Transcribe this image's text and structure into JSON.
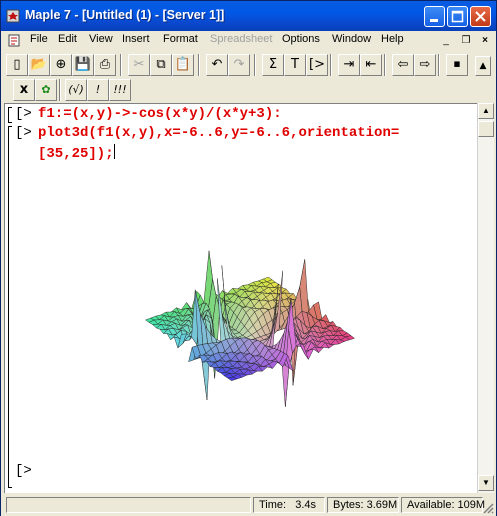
{
  "window": {
    "title": "Maple 7  - [Untitled (1) - [Server 1]]"
  },
  "menu": {
    "items": [
      {
        "label": "File",
        "enabled": true
      },
      {
        "label": "Edit",
        "enabled": true
      },
      {
        "label": "View",
        "enabled": true
      },
      {
        "label": "Insert",
        "enabled": true
      },
      {
        "label": "Format",
        "enabled": true
      },
      {
        "label": "Spreadsheet",
        "enabled": false
      },
      {
        "label": "Options",
        "enabled": true
      },
      {
        "label": "Window",
        "enabled": true
      },
      {
        "label": "Help",
        "enabled": true
      }
    ],
    "mdi_controls": [
      "_",
      "❐",
      "×"
    ]
  },
  "toolbar_main": [
    {
      "icon": "new-document-icon",
      "glyph": "▯"
    },
    {
      "icon": "open-folder-icon",
      "glyph": "📂"
    },
    {
      "icon": "open-url-icon",
      "glyph": "⊕"
    },
    {
      "icon": "save-icon",
      "glyph": "💾"
    },
    {
      "icon": "print-icon",
      "glyph": "⎙"
    },
    {
      "icon": "cut-icon",
      "glyph": "✂"
    },
    {
      "icon": "copy-icon",
      "glyph": "⧉"
    },
    {
      "icon": "paste-icon",
      "glyph": "📋"
    },
    {
      "icon": "undo-icon",
      "glyph": "↶"
    },
    {
      "icon": "redo-icon",
      "glyph": "↷"
    },
    {
      "icon": "sum-icon",
      "glyph": "Σ"
    },
    {
      "icon": "text-icon",
      "glyph": "T"
    },
    {
      "icon": "prompt-icon",
      "glyph": "[>"
    },
    {
      "icon": "indent-icon",
      "glyph": "⇥"
    },
    {
      "icon": "outdent-icon",
      "glyph": "⇤"
    },
    {
      "icon": "back-icon",
      "glyph": "⇦"
    },
    {
      "icon": "forward-icon",
      "glyph": "⇨"
    },
    {
      "icon": "stop-icon",
      "glyph": "⏹"
    }
  ],
  "toolbar_secondary": [
    {
      "icon": "math-mode-icon",
      "glyph": "x"
    },
    {
      "icon": "maple-leaf-icon",
      "glyph": "✿"
    },
    {
      "icon": "execute-region-icon",
      "glyph": "(√)"
    },
    {
      "icon": "execute-icon",
      "glyph": "!"
    },
    {
      "icon": "execute-all-icon",
      "glyph": "!!!"
    }
  ],
  "worksheet": {
    "prompts": [
      "[>",
      "[>",
      "[>"
    ],
    "line1": "f1:=(x,y)->-cos(x*y)/(x*y+3):",
    "line2": "plot3d(f1(x,y),x=-6..6,y=-6..6,orientation=",
    "line3": "[35,25]);"
  },
  "plot": {
    "function": "-cos(x*y)/(x*y+3)",
    "x_range": [
      -6,
      6
    ],
    "y_range": [
      -6,
      6
    ],
    "orientation": [
      35,
      25
    ],
    "colors": {
      "grid": "#222222"
    }
  },
  "status": {
    "time": "Time:   3.4s",
    "bytes": "Bytes: 3.69M",
    "available": "Available: 109M"
  },
  "colors": {
    "title_bar": "#0058e6",
    "code": "#e00000"
  }
}
